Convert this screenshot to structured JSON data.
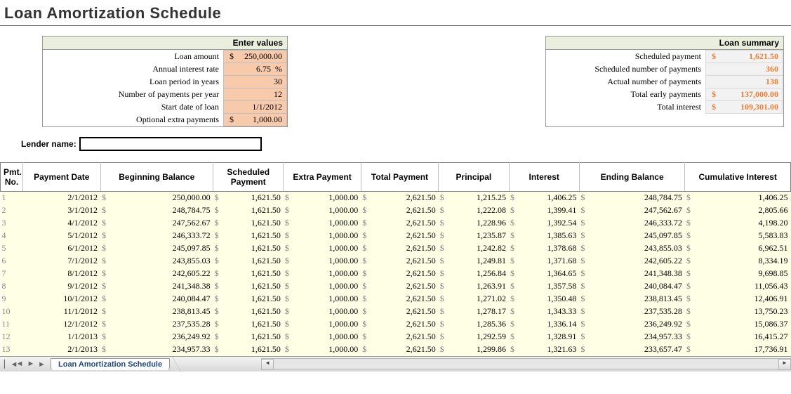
{
  "title": "Loan Amortization Schedule",
  "inputs_header": "Enter values",
  "summary_header": "Loan summary",
  "inputs": {
    "loan_amount_label": "Loan amount",
    "loan_amount": "250,000.00",
    "air_label": "Annual interest rate",
    "air": "6.75",
    "air_suffix": "%",
    "period_label": "Loan period in years",
    "period": "30",
    "npy_label": "Number of payments per year",
    "npy": "12",
    "start_label": "Start date of loan",
    "start": "1/1/2012",
    "extra_label": "Optional extra payments",
    "extra": "1,000.00"
  },
  "summary": {
    "sched_pay_label": "Scheduled payment",
    "sched_pay": "1,621.50",
    "sched_n_label": "Scheduled number of payments",
    "sched_n": "360",
    "actual_n_label": "Actual number of payments",
    "actual_n": "138",
    "early_label": "Total early payments",
    "early": "137,000.00",
    "tint_label": "Total interest",
    "tint": "109,301.00"
  },
  "lender_label": "Lender name:",
  "sched_headers": [
    "Pmt. No.",
    "Payment Date",
    "Beginning Balance",
    "Scheduled Payment",
    "Extra Payment",
    "Total Payment",
    "Principal",
    "Interest",
    "Ending Balance",
    "Cumulative Interest"
  ],
  "rows": [
    {
      "n": "1",
      "date": "2/1/2012",
      "beg": "250,000.00",
      "sp": "1,621.50",
      "ep": "1,000.00",
      "tp": "2,621.50",
      "pr": "1,215.25",
      "int": "1,406.25",
      "end": "248,784.75",
      "ci": "1,406.25"
    },
    {
      "n": "2",
      "date": "3/1/2012",
      "beg": "248,784.75",
      "sp": "1,621.50",
      "ep": "1,000.00",
      "tp": "2,621.50",
      "pr": "1,222.08",
      "int": "1,399.41",
      "end": "247,562.67",
      "ci": "2,805.66"
    },
    {
      "n": "3",
      "date": "4/1/2012",
      "beg": "247,562.67",
      "sp": "1,621.50",
      "ep": "1,000.00",
      "tp": "2,621.50",
      "pr": "1,228.96",
      "int": "1,392.54",
      "end": "246,333.72",
      "ci": "4,198.20"
    },
    {
      "n": "4",
      "date": "5/1/2012",
      "beg": "246,333.72",
      "sp": "1,621.50",
      "ep": "1,000.00",
      "tp": "2,621.50",
      "pr": "1,235.87",
      "int": "1,385.63",
      "end": "245,097.85",
      "ci": "5,583.83"
    },
    {
      "n": "5",
      "date": "6/1/2012",
      "beg": "245,097.85",
      "sp": "1,621.50",
      "ep": "1,000.00",
      "tp": "2,621.50",
      "pr": "1,242.82",
      "int": "1,378.68",
      "end": "243,855.03",
      "ci": "6,962.51"
    },
    {
      "n": "6",
      "date": "7/1/2012",
      "beg": "243,855.03",
      "sp": "1,621.50",
      "ep": "1,000.00",
      "tp": "2,621.50",
      "pr": "1,249.81",
      "int": "1,371.68",
      "end": "242,605.22",
      "ci": "8,334.19"
    },
    {
      "n": "7",
      "date": "8/1/2012",
      "beg": "242,605.22",
      "sp": "1,621.50",
      "ep": "1,000.00",
      "tp": "2,621.50",
      "pr": "1,256.84",
      "int": "1,364.65",
      "end": "241,348.38",
      "ci": "9,698.85"
    },
    {
      "n": "8",
      "date": "9/1/2012",
      "beg": "241,348.38",
      "sp": "1,621.50",
      "ep": "1,000.00",
      "tp": "2,621.50",
      "pr": "1,263.91",
      "int": "1,357.58",
      "end": "240,084.47",
      "ci": "11,056.43"
    },
    {
      "n": "9",
      "date": "10/1/2012",
      "beg": "240,084.47",
      "sp": "1,621.50",
      "ep": "1,000.00",
      "tp": "2,621.50",
      "pr": "1,271.02",
      "int": "1,350.48",
      "end": "238,813.45",
      "ci": "12,406.91"
    },
    {
      "n": "10",
      "date": "11/1/2012",
      "beg": "238,813.45",
      "sp": "1,621.50",
      "ep": "1,000.00",
      "tp": "2,621.50",
      "pr": "1,278.17",
      "int": "1,343.33",
      "end": "237,535.28",
      "ci": "13,750.23"
    },
    {
      "n": "11",
      "date": "12/1/2012",
      "beg": "237,535.28",
      "sp": "1,621.50",
      "ep": "1,000.00",
      "tp": "2,621.50",
      "pr": "1,285.36",
      "int": "1,336.14",
      "end": "236,249.92",
      "ci": "15,086.37"
    },
    {
      "n": "12",
      "date": "1/1/2013",
      "beg": "236,249.92",
      "sp": "1,621.50",
      "ep": "1,000.00",
      "tp": "2,621.50",
      "pr": "1,292.59",
      "int": "1,328.91",
      "end": "234,957.33",
      "ci": "16,415.27"
    },
    {
      "n": "13",
      "date": "2/1/2013",
      "beg": "234,957.33",
      "sp": "1,621.50",
      "ep": "1,000.00",
      "tp": "2,621.50",
      "pr": "1,299.86",
      "int": "1,321.63",
      "end": "233,657.47",
      "ci": "17,736.91"
    }
  ],
  "tab_name": "Loan Amortization Schedule"
}
